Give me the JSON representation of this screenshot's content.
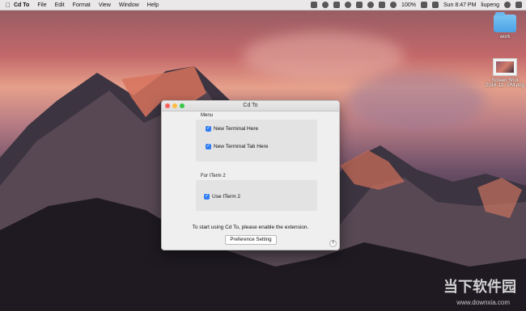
{
  "menubar": {
    "app_name": "Cd To",
    "items": [
      "File",
      "Edit",
      "Format",
      "View",
      "Window",
      "Help"
    ],
    "status": {
      "battery": "100%",
      "clock": "Sun 8:47 PM",
      "user": "liupeng"
    }
  },
  "desktop": {
    "icons": [
      {
        "label": "work",
        "type": "folder"
      },
      {
        "label": "Screen Shot\n2016-12...PM.png",
        "type": "screenshot"
      }
    ]
  },
  "window": {
    "title": "Cd To",
    "menu_section": {
      "label": "Menu",
      "options": [
        {
          "label": "New Terminal Here",
          "checked": true
        },
        {
          "label": "New Terminal Tab Here",
          "checked": true
        }
      ]
    },
    "iterm_section": {
      "label": "For ITerm 2",
      "options": [
        {
          "label": "Use ITerm 2",
          "checked": true
        }
      ]
    },
    "notice": "To start using Cd To, please enable the extension.",
    "button_label": "Preference Setting",
    "help_label": "?"
  },
  "watermark": {
    "text": "当下软件园",
    "url": "www.downxia.com"
  }
}
